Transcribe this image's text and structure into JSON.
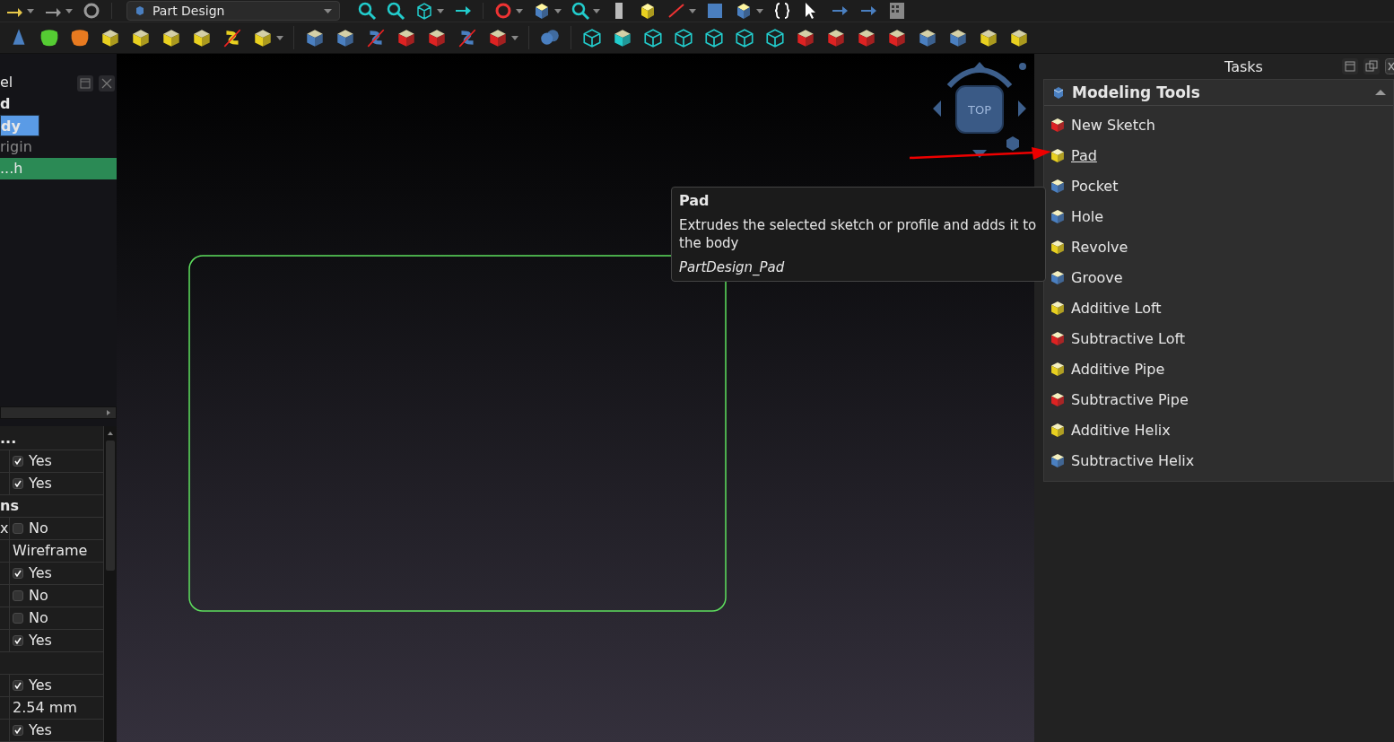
{
  "workbench": {
    "label": "Part Design"
  },
  "model_tree": {
    "items": [
      {
        "label": "el",
        "kind": "header",
        "selected": false,
        "active": false,
        "hidden": false
      },
      {
        "label": "d",
        "kind": "document",
        "selected": false,
        "active": false,
        "hidden": false
      },
      {
        "label": "dy",
        "kind": "body",
        "selected": false,
        "active": true,
        "hidden": false
      },
      {
        "label": "rigin",
        "kind": "feature",
        "selected": false,
        "active": false,
        "hidden": true
      },
      {
        "label": "...h",
        "kind": "feature",
        "selected": true,
        "active": false,
        "hidden": false
      }
    ]
  },
  "properties": {
    "rows": [
      {
        "kind": "group",
        "name": "..."
      },
      {
        "kind": "bool",
        "checked": true,
        "value": "Yes"
      },
      {
        "kind": "bool",
        "checked": true,
        "value": "Yes"
      },
      {
        "kind": "group",
        "name": "ns"
      },
      {
        "kind": "bool",
        "name": "x",
        "checked": false,
        "value": "No"
      },
      {
        "kind": "text",
        "value": "Wireframe"
      },
      {
        "kind": "bool",
        "checked": true,
        "value": "Yes"
      },
      {
        "kind": "bool",
        "checked": false,
        "value": "No"
      },
      {
        "kind": "bool",
        "checked": false,
        "value": "No"
      },
      {
        "kind": "bool",
        "checked": true,
        "value": "Yes"
      },
      {
        "kind": "group"
      },
      {
        "kind": "bool",
        "checked": true,
        "value": "Yes"
      },
      {
        "kind": "text",
        "value": "2.54 mm"
      },
      {
        "kind": "bool",
        "checked": true,
        "value": "Yes"
      }
    ]
  },
  "nav_cube": {
    "face": "TOP"
  },
  "tasks": {
    "title": "Tasks",
    "section": {
      "title": "Modeling Tools",
      "expanded": true,
      "items": [
        {
          "label": "New Sketch",
          "hovered": false
        },
        {
          "label": "Pad",
          "hovered": true
        },
        {
          "label": "Pocket",
          "hovered": false
        },
        {
          "label": "Hole",
          "hovered": false
        },
        {
          "label": "Revolve",
          "hovered": false
        },
        {
          "label": "Groove",
          "hovered": false
        },
        {
          "label": "Additive Loft",
          "hovered": false
        },
        {
          "label": "Subtractive Loft",
          "hovered": false
        },
        {
          "label": "Additive Pipe",
          "hovered": false
        },
        {
          "label": "Subtractive Pipe",
          "hovered": false
        },
        {
          "label": "Additive Helix",
          "hovered": false
        },
        {
          "label": "Subtractive Helix",
          "hovered": false
        }
      ]
    }
  },
  "tooltip": {
    "title": "Pad",
    "text": "Extrudes the selected sketch or profile and adds it to the body",
    "command": "PartDesign_Pad"
  }
}
